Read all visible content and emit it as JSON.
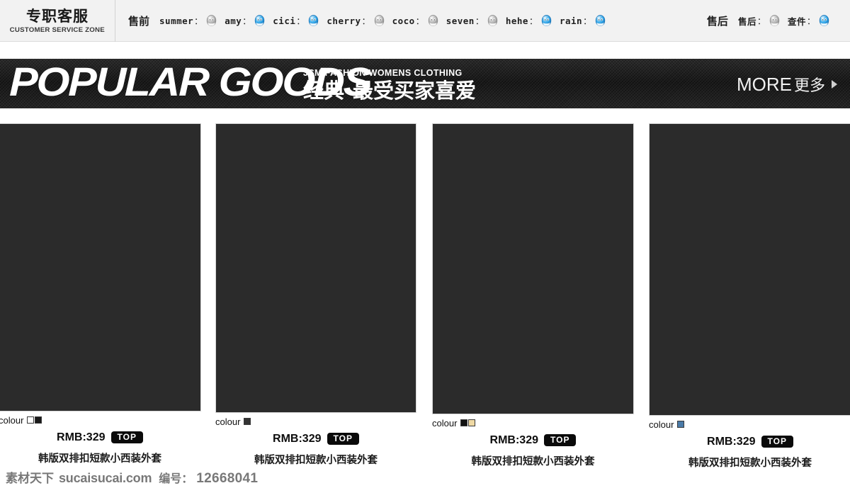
{
  "service_bar": {
    "logo": {
      "cn": "专职客服",
      "en": "CUSTOMER SERVICE ZONE"
    },
    "presale": {
      "title": "售前",
      "agents": [
        {
          "name": "summer",
          "separator": "：",
          "status": "offline",
          "icon": "aliwangwang-offline-icon"
        },
        {
          "name": "amy",
          "separator": "：",
          "status": "online",
          "icon": "aliwangwang-online-icon"
        },
        {
          "name": "cici",
          "separator": "：",
          "status": "online",
          "icon": "aliwangwang-online-icon"
        },
        {
          "name": "cherry",
          "separator": "：",
          "status": "offline",
          "icon": "aliwangwang-offline-icon"
        },
        {
          "name": "coco",
          "separator": "：",
          "status": "offline",
          "icon": "aliwangwang-offline-icon"
        },
        {
          "name": "seven",
          "separator": "：",
          "status": "offline",
          "icon": "aliwangwang-offline-icon"
        },
        {
          "name": "hehe",
          "separator": "：",
          "status": "online",
          "icon": "aliwangwang-online-icon"
        },
        {
          "name": "rain",
          "separator": "：",
          "status": "online",
          "icon": "aliwangwang-online-icon"
        }
      ]
    },
    "aftersale": {
      "title": "售后",
      "agents": [
        {
          "name": "售后",
          "separator": "：",
          "status": "offline",
          "icon": "aliwangwang-offline-icon"
        },
        {
          "name": "查件",
          "separator": "：",
          "status": "online",
          "icon": "aliwangwang-online-icon"
        }
      ]
    }
  },
  "banner": {
    "title": "POPULAR GOODS",
    "subtitle_en": "JSM  FASHION WOMENS CLOTHING",
    "subtitle_cn": "经典-最受买家喜爱",
    "more_en": "MORE",
    "more_cn": "更多",
    "more_arrow_icon": "triangle-right-icon"
  },
  "products": [
    {
      "colour_label": "colour",
      "swatches": [
        "#ffffff",
        "#1a1a1a"
      ],
      "price": "RMB:329",
      "badge": "TOP",
      "title": "韩版双排扣短款小西装外套"
    },
    {
      "colour_label": "colour",
      "swatches": [
        "#333333"
      ],
      "price": "RMB:329",
      "badge": "TOP",
      "title": "韩版双排扣短款小西装外套"
    },
    {
      "colour_label": "colour",
      "swatches": [
        "#111111",
        "#efd9a4"
      ],
      "price": "RMB:329",
      "badge": "TOP",
      "title": "韩版双排扣短款小西装外套"
    },
    {
      "colour_label": "colour",
      "swatches": [
        "#4a7ba8"
      ],
      "price": "RMB:329",
      "badge": "TOP",
      "title": "韩版双排扣短款小西装外套"
    }
  ],
  "watermark": {
    "site_cn": "素材天下",
    "site_url": "sucaisucai.com",
    "id_label": "编号：",
    "id_value": "12668041"
  },
  "colors": {
    "bar_background": "#f2f2f2",
    "banner_background": "#1c1c1c",
    "card_placeholder": "#2b2b2b",
    "badge_background": "#0a0a0a",
    "online_icon": "#2f9bdc",
    "offline_icon": "#a8a8a8"
  }
}
